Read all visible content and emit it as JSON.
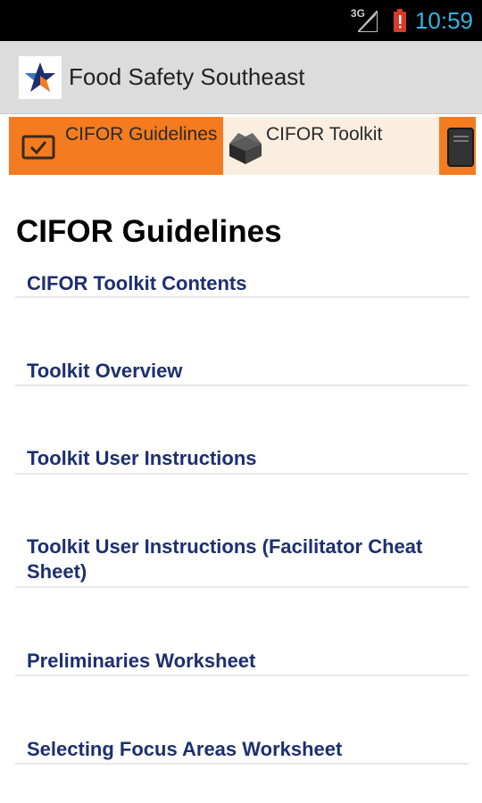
{
  "status_bar": {
    "network": "3G",
    "time": "10:59",
    "battery_color": "#d63b2b",
    "clock_color": "#33b5e5"
  },
  "app_bar": {
    "title": "Food Safety Southeast",
    "logo_icon": "star-icon"
  },
  "tabs": [
    {
      "label": "CIFOR Guidelines",
      "icon": "checkbox-icon",
      "selected": true
    },
    {
      "label": "CIFOR Toolkit",
      "icon": "box-icon",
      "selected": false
    },
    {
      "label": "",
      "icon": "book-icon",
      "selected": false
    }
  ],
  "page": {
    "title": "CIFOR Guidelines"
  },
  "items": [
    "CIFOR Toolkit Contents",
    "Toolkit Overview",
    "Toolkit User Instructions",
    "Toolkit User Instructions (Facilitator Cheat Sheet)",
    "Preliminaries Worksheet",
    "Selecting Focus Areas Worksheet"
  ],
  "colors": {
    "accent": "#f47b20",
    "tab_strip_background": "#faeee0",
    "link": "#1d2f6f",
    "app_bar": "#dcdcdc"
  }
}
